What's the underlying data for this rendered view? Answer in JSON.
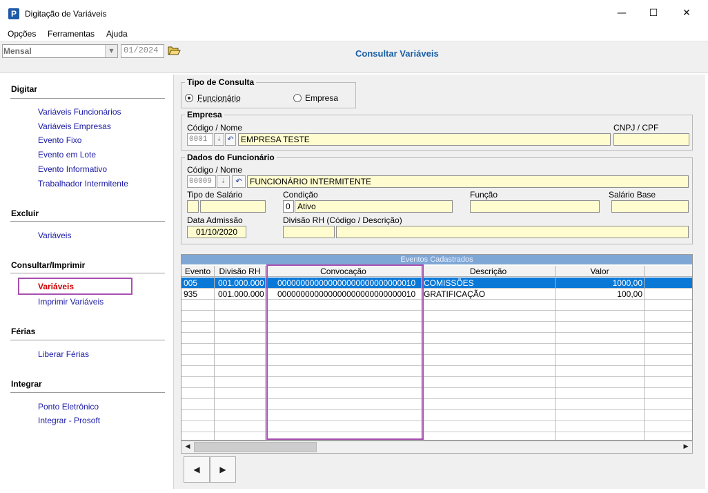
{
  "window": {
    "icon_letter": "P",
    "title": "Digitação de Variáveis",
    "minimize": "—",
    "maximize": "☐",
    "close": "✕"
  },
  "menu": [
    "Opções",
    "Ferramentas",
    "Ajuda"
  ],
  "toolbar": {
    "period": "Mensal",
    "month": "01/2024",
    "page_title": "Consultar Variáveis"
  },
  "sidebar": {
    "digitar": {
      "title": "Digitar",
      "items": [
        "Variáveis Funcionários",
        "Variáveis Empresas",
        "Evento Fixo",
        "Evento em Lote",
        "Evento Informativo",
        "Trabalhador Intermitente"
      ]
    },
    "excluir": {
      "title": "Excluir",
      "items": [
        "Variáveis"
      ]
    },
    "consultar": {
      "title": "Consultar/Imprimir",
      "items": [
        "Variáveis",
        "Imprimir Variáveis"
      ]
    },
    "ferias": {
      "title": "Férias",
      "items": [
        "Liberar Férias"
      ]
    },
    "integrar": {
      "title": "Integrar",
      "items": [
        "Ponto Eletrônico",
        "Integrar - Prosoft"
      ]
    }
  },
  "tipo_consulta": {
    "title": "Tipo de Consulta",
    "opt_funcionario": "Funcionário",
    "opt_empresa": "Empresa",
    "selected": "Funcionário"
  },
  "empresa": {
    "title": "Empresa",
    "codigo_label": "Código / Nome",
    "codigo": "0001",
    "nome": "EMPRESA TESTE",
    "cnpj_label": "CNPJ / CPF",
    "cnpj": ""
  },
  "funcionario": {
    "title": "Dados do Funcionário",
    "codigo_label": "Código / Nome",
    "codigo": "00009",
    "nome": "FUNCIONÁRIO INTERMITENTE",
    "tipo_salario_label": "Tipo de Salário",
    "tipo_salario_code": "",
    "tipo_salario": "",
    "condicao_label": "Condição",
    "condicao_code": "0",
    "condicao": "Ativo",
    "funcao_label": "Função",
    "funcao": "",
    "salario_label": "Salário Base",
    "salario": "",
    "admissao_label": "Data Admissão",
    "admissao": "01/10/2020",
    "divisao_label": "Divisão RH (Código / Descrição)",
    "divisao_code": "",
    "divisao": ""
  },
  "grid": {
    "caption": "Eventos Cadastrados",
    "headers": [
      "Evento",
      "Divisão RH",
      "Convocação",
      "Descrição",
      "Valor"
    ],
    "rows": [
      {
        "evento": "005",
        "divisao": "001.000.000",
        "convocacao": "000000000000000000000000000010",
        "descricao": "COMISSÕES",
        "valor": "1000,00"
      },
      {
        "evento": "935",
        "divisao": "001.000.000",
        "convocacao": "000000000000000000000000000010",
        "descricao": "GRATIFICAÇÃO",
        "valor": "100,00"
      }
    ]
  },
  "scrollbar": {
    "left": "◀",
    "right": "▶"
  },
  "nav": {
    "prev": "◀",
    "next": "▶"
  },
  "icons": {
    "folder": "folder-open-icon",
    "lookup": "⇣",
    "undo": "↶",
    "dropdown": "▼"
  },
  "colors": {
    "accent_blue": "#1a5ea6",
    "link_blue": "#1a1aa6",
    "active_red": "#cc0000",
    "highlight_purple": "#a84fb0",
    "field_yellow": "#fffdcf",
    "selection": "#0a78d7"
  }
}
